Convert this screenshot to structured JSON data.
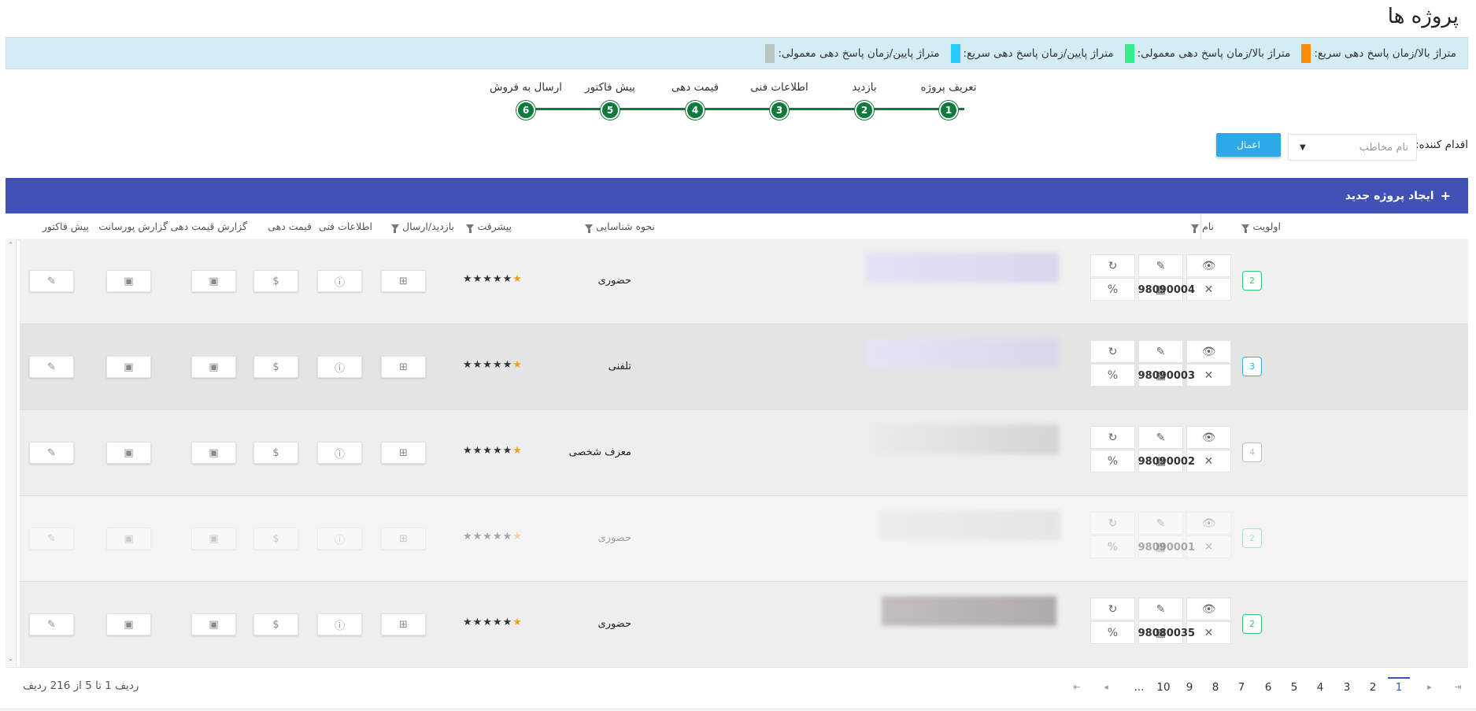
{
  "page_title": "پروژه ها",
  "legend": [
    {
      "label": "متراژ بالا/زمان پاسخ دهی سریع:",
      "color": "#ff8c00"
    },
    {
      "label": "متراژ بالا/زمان پاسخ دهی معمولی:",
      "color": "#33ee88"
    },
    {
      "label": "متراژ پایین/زمان پاسخ دهی سریع:",
      "color": "#22ccff"
    },
    {
      "label": "متراژ پایین/زمان پاسخ دهی معمولی:",
      "color": "#b7c7bd"
    }
  ],
  "steps": [
    {
      "label": "تعریف پروژه",
      "num": "1"
    },
    {
      "label": "بازدید",
      "num": "2"
    },
    {
      "label": "اطلاعات فنی",
      "num": "3"
    },
    {
      "label": "قیمت دهی",
      "num": "4"
    },
    {
      "label": "پیش فاکتور",
      "num": "5"
    },
    {
      "label": "ارسال به فروش",
      "num": "6"
    }
  ],
  "filter": {
    "actor_label": "اقدام کننده:",
    "actor_placeholder": "نام مخاطب",
    "apply_label": "اعمال"
  },
  "toolbar": {
    "new_project_label": "ایجاد پروژه جدید"
  },
  "columns": {
    "priority": "اولویت",
    "name": "نام",
    "identification": "نحوه شناسایی",
    "progress": "پیشرفت",
    "visit_send": "بازدید/ارسال",
    "tech_info": "اطلاعات فنی",
    "pricing": "قیمت دهی",
    "pricing_report": "گزارش قیمت دهی",
    "commission_report": "گزارش پورسانت",
    "proforma": "پیش فاکتور"
  },
  "rows": [
    {
      "priority": "2",
      "code": "98090004",
      "method": "حضوری",
      "stars_dark": "★★★★★",
      "stars_gold": "★"
    },
    {
      "priority": "3",
      "code": "98090003",
      "method": "تلفنی",
      "stars_dark": "★★★★★",
      "stars_gold": "★"
    },
    {
      "priority": "4",
      "code": "98090002",
      "method": "معرف شخصی",
      "stars_dark": "★★★★★",
      "stars_gold": "★"
    },
    {
      "priority": "2",
      "code": "98090001",
      "method": "حضوری",
      "stars_dark": "★★★★★",
      "stars_gold": "★"
    },
    {
      "priority": "2",
      "code": "98080035",
      "method": "حضوری",
      "stars_dark": "★★★★★",
      "stars_gold": "★"
    }
  ],
  "row_action_icons": [
    "eye-icon",
    "pencil-icon",
    "refresh-icon",
    "close-icon",
    "document-icon",
    "percent-icon"
  ],
  "row_cell_icons": [
    "table-icon",
    "info-icon",
    "dollar-icon",
    "excel-icon",
    "excel-icon",
    "edit-doc-icon"
  ],
  "pager": {
    "info": "ردیف 1 تا 5 از 216 ردیف",
    "pages": [
      "1",
      "2",
      "3",
      "4",
      "5",
      "6",
      "7",
      "8",
      "9",
      "10",
      "..."
    ],
    "active_page": "1"
  }
}
